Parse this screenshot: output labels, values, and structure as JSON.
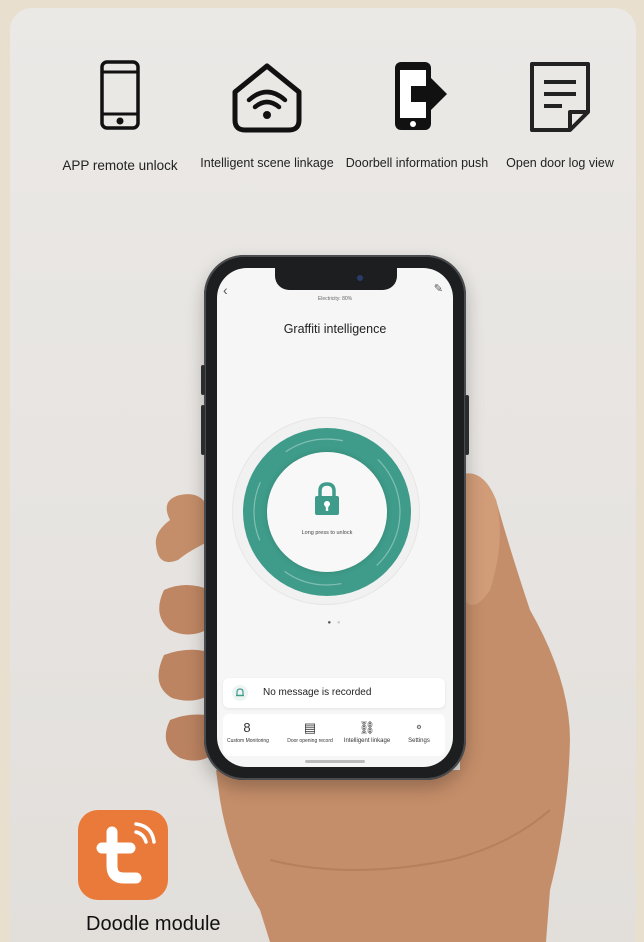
{
  "features": [
    {
      "icon": "smartphone-icon",
      "label": "APP remote unlock"
    },
    {
      "icon": "wifi-home-icon",
      "label": "Intelligent scene linkage"
    },
    {
      "icon": "phone-push-icon",
      "label": "Doorbell information push"
    },
    {
      "icon": "document-log-icon",
      "label": "Open door log view"
    }
  ],
  "app": {
    "battery": "Electricity: 80%",
    "title": "Graffiti intelligence",
    "unlock_hint": "Long press to unlock",
    "message": "No message is recorded",
    "tabs": [
      {
        "icon_text": "8",
        "label": "Custom Monitoring"
      },
      {
        "icon": "record-icon",
        "label": "Door opening record"
      },
      {
        "icon": "link-icon",
        "label": "Intelligent linkage"
      },
      {
        "icon": "settings-icon",
        "label": "Settings"
      }
    ]
  },
  "brand": {
    "name": "Doodle module",
    "color": "#e97a3a",
    "accent": "#3f9c8a"
  }
}
